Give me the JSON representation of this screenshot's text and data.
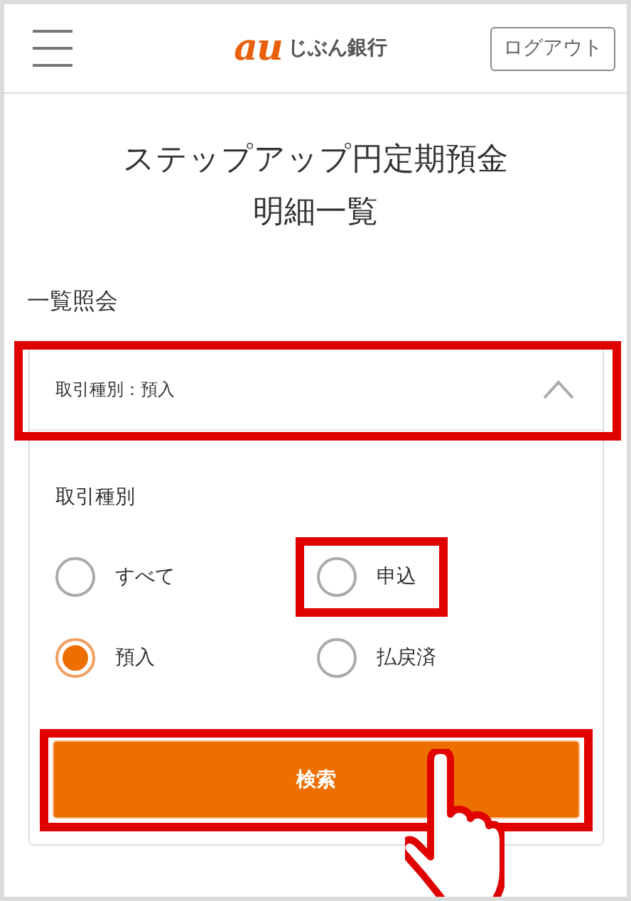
{
  "header": {
    "logo": {
      "mark": "au",
      "name": "じぶん銀行"
    },
    "logout_button": "ログアウト"
  },
  "title_lines": [
    "ステップアップ円定期預金",
    "明細一覧"
  ],
  "section_heading": "一覧照会",
  "filter": {
    "summary": "取引種別：預入",
    "expanded": true,
    "highlighted": true,
    "field_label": "取引種別",
    "options": [
      {
        "label": "すべて",
        "selected": false,
        "highlighted": false
      },
      {
        "label": "申込",
        "selected": false,
        "highlighted": true
      },
      {
        "label": "預入",
        "selected": true,
        "highlighted": false
      },
      {
        "label": "払戻済",
        "selected": false,
        "highlighted": false
      }
    ],
    "search_button": {
      "label": "検索",
      "highlighted": true
    }
  }
}
